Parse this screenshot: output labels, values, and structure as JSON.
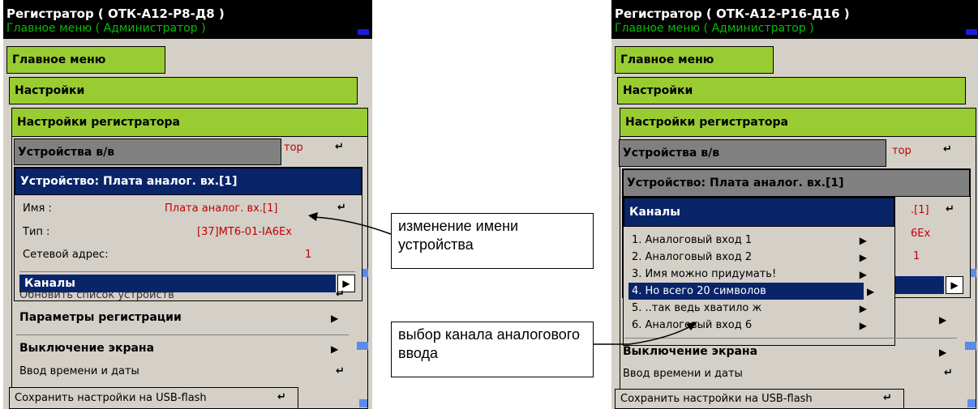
{
  "left": {
    "title": "Регистратор ( ОТК-А12-Р8-Д8 )",
    "subtitle": "Главное меню ( Администратор )",
    "main_menu": "Главное меню",
    "settings": "Настройки",
    "recorder_settings": "Настройки регистратора",
    "devices_io": "Устройства в/в",
    "behind_text": "тор",
    "dialog_title": "Устройство: Плата аналог. вх.[1]",
    "name_label": "Имя :",
    "name_value": "Плата аналог. вх.[1]",
    "type_label": "Тип :",
    "type_value": "[37]МТ6-01-IA6Ex",
    "net_label": "Сетевой адрес:",
    "net_value": "1",
    "channels": "Каналы",
    "update_devices": "Обновить список устройств",
    "reg_params": "Параметры регистрации",
    "screen_off": "Выключение экрана",
    "time_date": "Ввод времени и даты",
    "save_usb": "Сохранить настройки на USB-flash"
  },
  "right": {
    "title": "Регистратор ( ОТК-А12-Р16-Д16 )",
    "subtitle": "Главное меню ( Администратор )",
    "main_menu": "Главное меню",
    "settings": "Настройки",
    "recorder_settings": "Настройки регистратора",
    "devices_io": "Устройства в/в",
    "behind_text": "тор",
    "dialog_title": "Устройство: Плата аналог. вх.[1]",
    "behind_name": ".[1]",
    "behind_type": "6Ex",
    "behind_net": "1",
    "channels_title": "Каналы",
    "channels": [
      "1. Аналоговый вход 1",
      "2. Аналоговый вход 2",
      "3. Имя можно придумать!",
      "4. Но всего 20 символов",
      "5. ..так ведь хватило ж",
      "6. Аналоговый вход 6"
    ],
    "screen_off": "Выключение экрана",
    "time_date": "Ввод времени и даты",
    "save_usb": "Сохранить настройки на USB-flash"
  },
  "callouts": {
    "rename": "изменение имени устройства",
    "channel_select": "выбор канала аналогового ввода"
  },
  "glyphs": {
    "enter": "↵",
    "arrow": "▶"
  }
}
